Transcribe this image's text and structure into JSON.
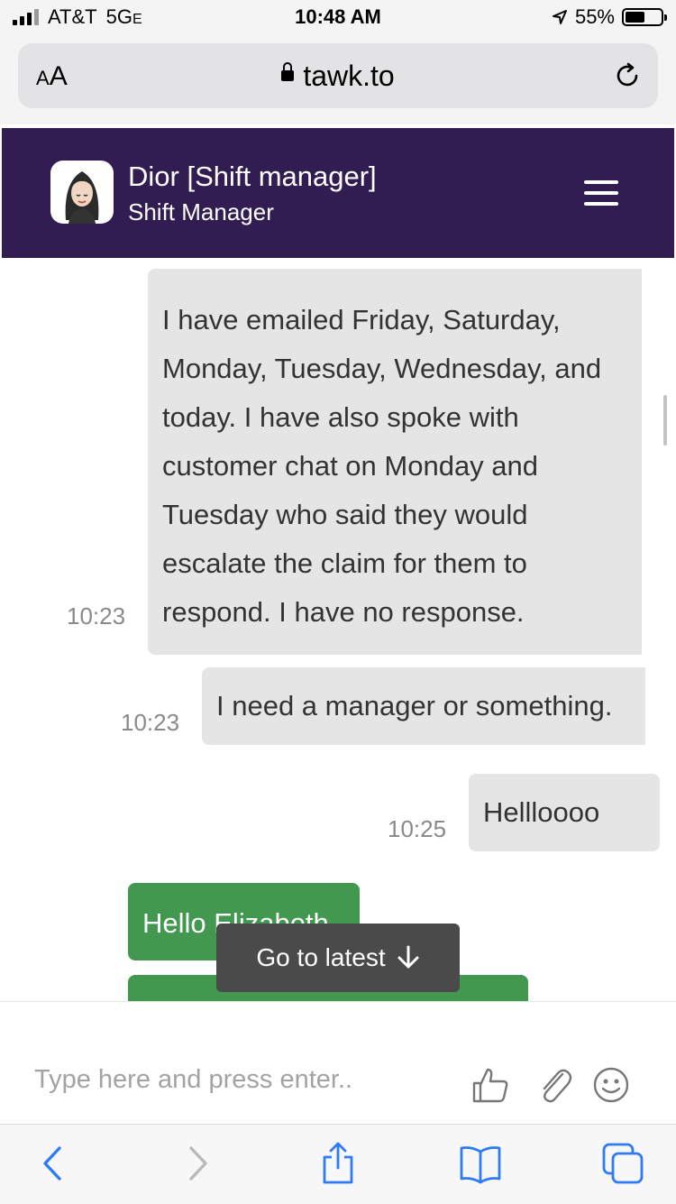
{
  "status_bar": {
    "carrier": "AT&T",
    "network": "5G",
    "network_suffix": "E",
    "time": "10:48 AM",
    "battery": "55%",
    "battery_level": 0.55
  },
  "browser": {
    "text_size_label_small": "A",
    "text_size_label_large": "A",
    "domain": "tawk.to"
  },
  "chat_header": {
    "agent_name": "Dior [Shift manager]",
    "agent_role": "Shift Manager"
  },
  "messages": [
    {
      "text": "I have emailed Friday, Saturday, Monday, Tuesday, Wednesday, and today. I have also spoke with customer chat on Monday and Tuesday who said they would escalate the claim for them to respond. I have no response.",
      "time": "10:23",
      "sender": "visitor"
    },
    {
      "text": "I need a manager or something.",
      "time": "10:23",
      "sender": "visitor"
    },
    {
      "text": "Hellloooo",
      "time": "10:25",
      "sender": "visitor"
    },
    {
      "text": "Hello Elizabeth",
      "sender": "agent"
    }
  ],
  "go_to_latest": "Go to latest",
  "composer": {
    "placeholder": "Type here and press enter.."
  },
  "colors": {
    "header_bg": "#321d53",
    "agent_bubble": "#41984e",
    "visitor_bubble": "#e5e5e5",
    "toolbar_blue": "#2f7bf6"
  }
}
